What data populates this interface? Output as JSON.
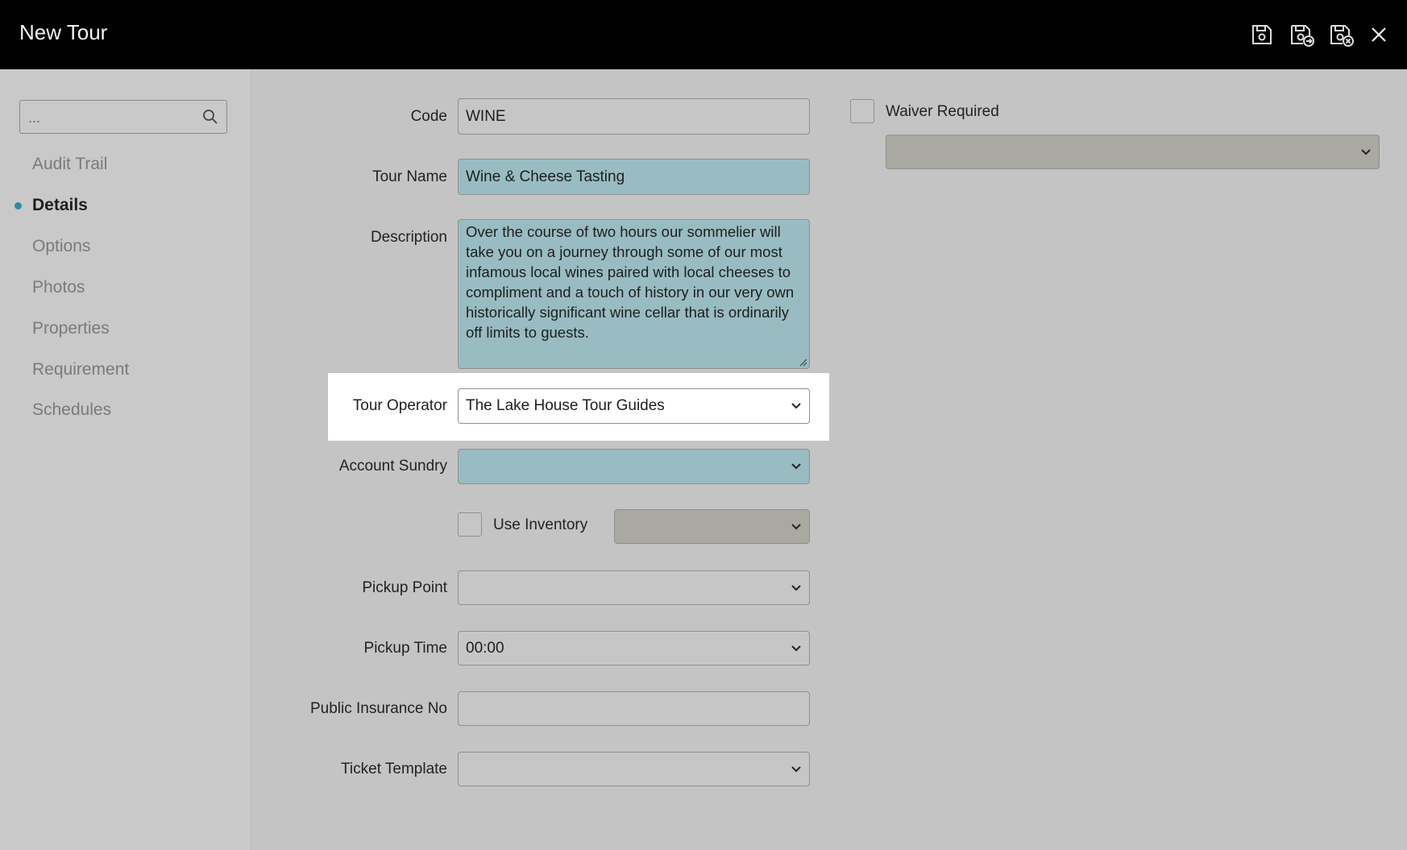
{
  "window": {
    "title": "New Tour",
    "toolbar": [
      "save-icon",
      "save-and-new-icon",
      "save-and-close-icon",
      "close-icon"
    ]
  },
  "sidebar": {
    "search_placeholder": "...",
    "items": [
      {
        "label": "Audit Trail",
        "active": false
      },
      {
        "label": "Details",
        "active": true
      },
      {
        "label": "Options",
        "active": false
      },
      {
        "label": "Photos",
        "active": false
      },
      {
        "label": "Properties",
        "active": false
      },
      {
        "label": "Requirement",
        "active": false
      },
      {
        "label": "Schedules",
        "active": false
      }
    ]
  },
  "form": {
    "code": {
      "label": "Code",
      "value": "WINE"
    },
    "tour_name": {
      "label": "Tour Name",
      "value": "Wine & Cheese Tasting"
    },
    "description": {
      "label": "Description",
      "value": "Over the course of two hours our sommelier will take you on a journey through some of our most infamous local wines paired with local cheeses to compliment and a touch of history in our very own historically significant wine cellar that is ordinarily off limits to guests."
    },
    "tour_operator": {
      "label": "Tour Operator",
      "value": "The Lake House Tour Guides"
    },
    "account_sundry": {
      "label": "Account Sundry",
      "value": ""
    },
    "use_inventory": {
      "label": "Use Inventory",
      "checked": false,
      "select_value": ""
    },
    "pickup_point": {
      "label": "Pickup Point",
      "value": ""
    },
    "pickup_time": {
      "label": "Pickup Time",
      "value": "00:00"
    },
    "public_insurance_no": {
      "label": "Public Insurance No",
      "value": ""
    },
    "ticket_template": {
      "label": "Ticket Template",
      "value": ""
    },
    "waiver_required": {
      "label": "Waiver Required",
      "checked": false,
      "select_value": ""
    }
  },
  "colors": {
    "header_bg": "#000000",
    "active_dot": "#2a8fa0",
    "mandatory_field": "#98bcc1",
    "disabled_field": "#aaa9a1"
  }
}
